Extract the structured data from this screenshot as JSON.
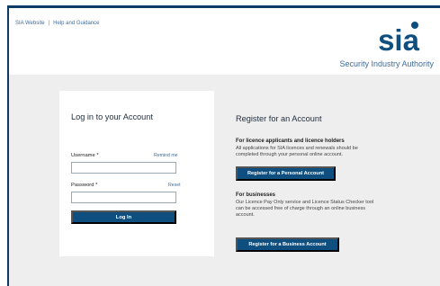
{
  "header": {
    "links": {
      "sia_website": "SIA Website",
      "separator": "|",
      "help": "Help and Guidance"
    },
    "logo": {
      "name": "sia",
      "wordmark": "Security Industry Authority"
    }
  },
  "login": {
    "title": "Log in to your Account",
    "username": {
      "label": "Username *",
      "link": "Remind me",
      "value": ""
    },
    "password": {
      "label": "Password *",
      "link": "Reset",
      "value": ""
    },
    "submit": "Log In"
  },
  "register": {
    "title": "Register for an Account",
    "personal": {
      "heading": "For licence applicants and licence holders",
      "line1": "All applications for SIA licences and renewals should be",
      "line2": "completed through your personal online account.",
      "button": "Register for a Personal Account"
    },
    "business": {
      "heading": "For businesses",
      "line1": "Our Licence Pay Only service and Licence Status Checker tool",
      "line2": "can be accessed free of charge through an online business",
      "line3": "account.",
      "button": "Register for a Business Account"
    }
  },
  "icons": {
    "logo": "sia-logo-icon"
  },
  "colors": {
    "brand_blue": "#0e4f80",
    "link_blue": "#3f6d9c",
    "page_background": "#eeeeee"
  }
}
